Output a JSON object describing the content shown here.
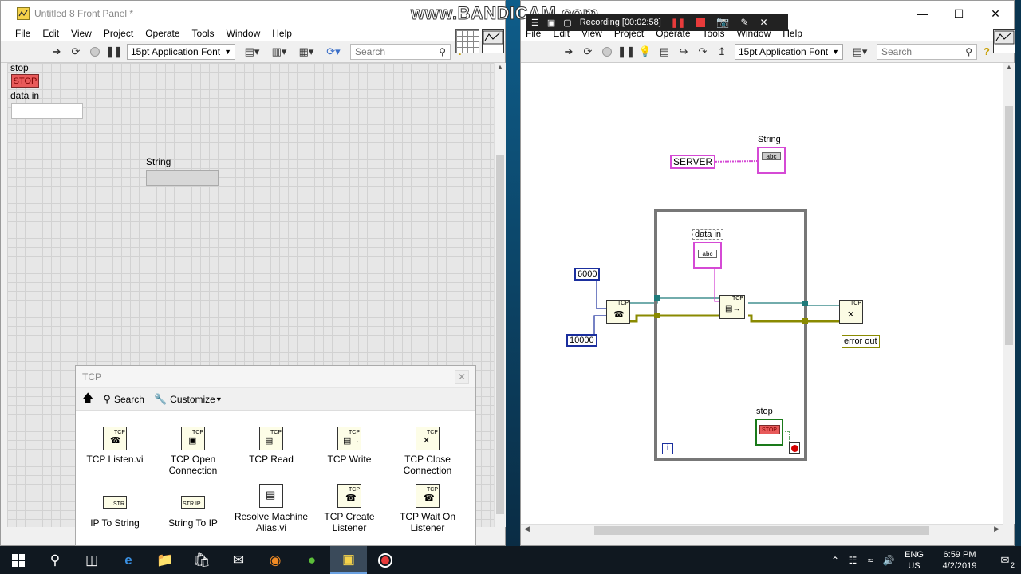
{
  "front_panel": {
    "title": "Untitled 8 Front Panel *",
    "menu": [
      "File",
      "Edit",
      "View",
      "Project",
      "Operate",
      "Tools",
      "Window",
      "Help"
    ],
    "font": "15pt Application Font",
    "search_placeholder": "Search",
    "controls": {
      "stop_label": "stop",
      "stop_button": "STOP",
      "data_in_label": "data in",
      "data_in_value": "",
      "string_label": "String",
      "string_value": ""
    }
  },
  "block_diagram": {
    "menu": [
      "File",
      "Edit",
      "View",
      "Project",
      "Operate",
      "Tools",
      "Window",
      "Help"
    ],
    "font": "15pt Application Font",
    "search_placeholder": "Search",
    "nodes": {
      "server_const": "SERVER",
      "string_indicator": "String",
      "data_in": "data in",
      "port_const": "6000",
      "timeout_const": "10000",
      "error_out": "error out",
      "stop": "stop",
      "loop_index": "i",
      "tcp_tag": "TCP",
      "abc_tag": "abc",
      "stop_tag": "STOP"
    }
  },
  "recorder": {
    "watermark": "www.BANDICAM.com",
    "status": "Recording [00:02:58]"
  },
  "palette": {
    "title": "TCP",
    "search_label": "Search",
    "customize_label": "Customize",
    "items": [
      {
        "label": "TCP Listen.vi"
      },
      {
        "label": "TCP Open Connection"
      },
      {
        "label": "TCP Read"
      },
      {
        "label": "TCP Write"
      },
      {
        "label": "TCP Close Connection"
      },
      {
        "label": "IP To String"
      },
      {
        "label": "String To IP"
      },
      {
        "label": "Resolve Machine Alias.vi"
      },
      {
        "label": "TCP Create Listener"
      },
      {
        "label": "TCP Wait On Listener"
      }
    ],
    "icon_tags": [
      "TCP",
      "STR",
      "STR IP"
    ]
  },
  "taskbar": {
    "lang_top": "ENG",
    "lang_bottom": "US",
    "time": "6:59 PM",
    "date": "4/2/2019",
    "notification_count": "2"
  },
  "colors": {
    "string_wire": "#d54ad5",
    "error_wire": "#8a8a00",
    "ref_wire": "#1f7a7a",
    "int_wire": "#1b2f9e",
    "bool_green": "#1a7a1a",
    "stop_red": "#e85a5a"
  }
}
